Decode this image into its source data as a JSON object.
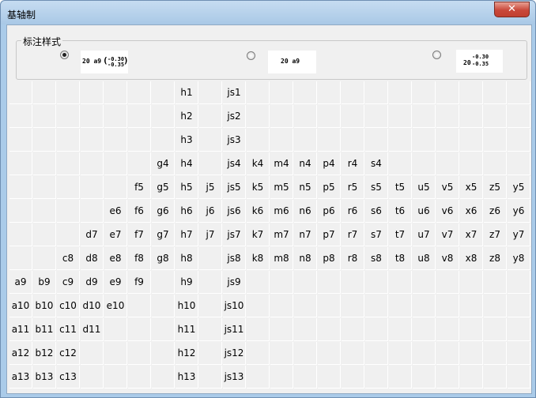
{
  "window": {
    "title": "基轴制",
    "close_label": "✕"
  },
  "group": {
    "label": "标注样式"
  },
  "styles": [
    {
      "selected": true,
      "main": "20 a9",
      "upper": "-0.30",
      "lower": "-0.35",
      "paren_open": "(",
      "paren_close": ")"
    },
    {
      "selected": false,
      "main": "20 a9"
    },
    {
      "selected": false,
      "main": "20",
      "upper": "-0.30",
      "lower": "-0.35"
    }
  ],
  "grid": [
    [
      "",
      "",
      "",
      "",
      "",
      "",
      "",
      "h1",
      "",
      "js1",
      "",
      "",
      "",
      "",
      "",
      "",
      "",
      "",
      "",
      "",
      "",
      ""
    ],
    [
      "",
      "",
      "",
      "",
      "",
      "",
      "",
      "h2",
      "",
      "js2",
      "",
      "",
      "",
      "",
      "",
      "",
      "",
      "",
      "",
      "",
      "",
      ""
    ],
    [
      "",
      "",
      "",
      "",
      "",
      "",
      "",
      "h3",
      "",
      "js3",
      "",
      "",
      "",
      "",
      "",
      "",
      "",
      "",
      "",
      "",
      "",
      ""
    ],
    [
      "",
      "",
      "",
      "",
      "",
      "",
      "g4",
      "h4",
      "",
      "js4",
      "k4",
      "m4",
      "n4",
      "p4",
      "r4",
      "s4",
      "",
      "",
      "",
      "",
      "",
      ""
    ],
    [
      "",
      "",
      "",
      "",
      "",
      "f5",
      "g5",
      "h5",
      "j5",
      "js5",
      "k5",
      "m5",
      "n5",
      "p5",
      "r5",
      "s5",
      "t5",
      "u5",
      "v5",
      "x5",
      "z5",
      "y5"
    ],
    [
      "",
      "",
      "",
      "",
      "e6",
      "f6",
      "g6",
      "h6",
      "j6",
      "js6",
      "k6",
      "m6",
      "n6",
      "p6",
      "r6",
      "s6",
      "t6",
      "u6",
      "v6",
      "x6",
      "z6",
      "y6"
    ],
    [
      "",
      "",
      "",
      "d7",
      "e7",
      "f7",
      "g7",
      "h7",
      "j7",
      "js7",
      "k7",
      "m7",
      "n7",
      "p7",
      "r7",
      "s7",
      "t7",
      "u7",
      "v7",
      "x7",
      "z7",
      "y7"
    ],
    [
      "",
      "",
      "c8",
      "d8",
      "e8",
      "f8",
      "g8",
      "h8",
      "",
      "js8",
      "k8",
      "m8",
      "n8",
      "p8",
      "r8",
      "s8",
      "t8",
      "u8",
      "v8",
      "x8",
      "z8",
      "y8"
    ],
    [
      "a9",
      "b9",
      "c9",
      "d9",
      "e9",
      "f9",
      "",
      "h9",
      "",
      "js9",
      "",
      "",
      "",
      "",
      "",
      "",
      "",
      "",
      "",
      "",
      "",
      ""
    ],
    [
      "a10",
      "b10",
      "c10",
      "d10",
      "e10",
      "",
      "",
      "h10",
      "",
      "js10",
      "",
      "",
      "",
      "",
      "",
      "",
      "",
      "",
      "",
      "",
      "",
      ""
    ],
    [
      "a11",
      "b11",
      "c11",
      "d11",
      "",
      "",
      "",
      "h11",
      "",
      "js11",
      "",
      "",
      "",
      "",
      "",
      "",
      "",
      "",
      "",
      "",
      "",
      ""
    ],
    [
      "a12",
      "b12",
      "c12",
      "",
      "",
      "",
      "",
      "h12",
      "",
      "js12",
      "",
      "",
      "",
      "",
      "",
      "",
      "",
      "",
      "",
      "",
      "",
      ""
    ],
    [
      "a13",
      "b13",
      "c13",
      "",
      "",
      "",
      "",
      "h13",
      "",
      "js13",
      "",
      "",
      "",
      "",
      "",
      "",
      "",
      "",
      "",
      "",
      "",
      ""
    ]
  ]
}
